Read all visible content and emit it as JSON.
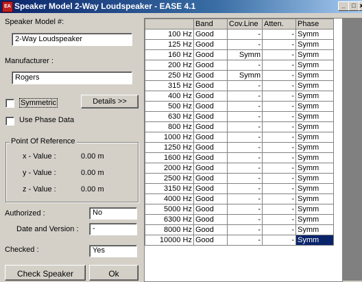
{
  "window": {
    "title": "Speaker Model 2-Way Loudspeaker - EASE 4.1",
    "min": "_",
    "max": "□",
    "close": "x"
  },
  "form": {
    "model_label": "Speaker Model #:",
    "model_value": "2-Way Loudspeaker",
    "manufacturer_label": "Manufacturer :",
    "manufacturer_value": "Rogers",
    "symmetric_label": "Symmetric",
    "details_button": "Details >>",
    "phase_label": "Use Phase Data",
    "por_title": "Point Of Reference",
    "x_label": "x - Value :",
    "x_value": "0.00 m",
    "y_label": "y - Value :",
    "y_value": "0.00 m",
    "z_label": "z - Value :",
    "z_value": "0.00 m",
    "authorized_label": "Authorized :",
    "authorized_value": "No",
    "date_label": "Date and Version :",
    "date_value": "-",
    "checked_label": "Checked :",
    "checked_value": "Yes",
    "check_button": "Check Speaker",
    "ok_button": "Ok"
  },
  "table": {
    "headers": [
      "",
      "Band",
      "Cov.Line",
      "Atten.",
      "Phase"
    ],
    "rows": [
      [
        "100 Hz",
        "Good",
        "-",
        "-",
        "Symm"
      ],
      [
        "125 Hz",
        "Good",
        "-",
        "-",
        "Symm"
      ],
      [
        "160 Hz",
        "Good",
        "Symm",
        "-",
        "Symm"
      ],
      [
        "200 Hz",
        "Good",
        "-",
        "-",
        "Symm"
      ],
      [
        "250 Hz",
        "Good",
        "Symm",
        "-",
        "Symm"
      ],
      [
        "315 Hz",
        "Good",
        "-",
        "-",
        "Symm"
      ],
      [
        "400 Hz",
        "Good",
        "-",
        "-",
        "Symm"
      ],
      [
        "500 Hz",
        "Good",
        "-",
        "-",
        "Symm"
      ],
      [
        "630 Hz",
        "Good",
        "-",
        "-",
        "Symm"
      ],
      [
        "800 Hz",
        "Good",
        "-",
        "-",
        "Symm"
      ],
      [
        "1000 Hz",
        "Good",
        "-",
        "-",
        "Symm"
      ],
      [
        "1250 Hz",
        "Good",
        "-",
        "-",
        "Symm"
      ],
      [
        "1600 Hz",
        "Good",
        "-",
        "-",
        "Symm"
      ],
      [
        "2000 Hz",
        "Good",
        "-",
        "-",
        "Symm"
      ],
      [
        "2500 Hz",
        "Good",
        "-",
        "-",
        "Symm"
      ],
      [
        "3150 Hz",
        "Good",
        "-",
        "-",
        "Symm"
      ],
      [
        "4000 Hz",
        "Good",
        "-",
        "-",
        "Symm"
      ],
      [
        "5000 Hz",
        "Good",
        "-",
        "-",
        "Symm"
      ],
      [
        "6300 Hz",
        "Good",
        "-",
        "-",
        "Symm"
      ],
      [
        "8000 Hz",
        "Good",
        "-",
        "-",
        "Symm"
      ],
      [
        "10000 Hz",
        "Good",
        "-",
        "-",
        "Symm"
      ]
    ]
  }
}
